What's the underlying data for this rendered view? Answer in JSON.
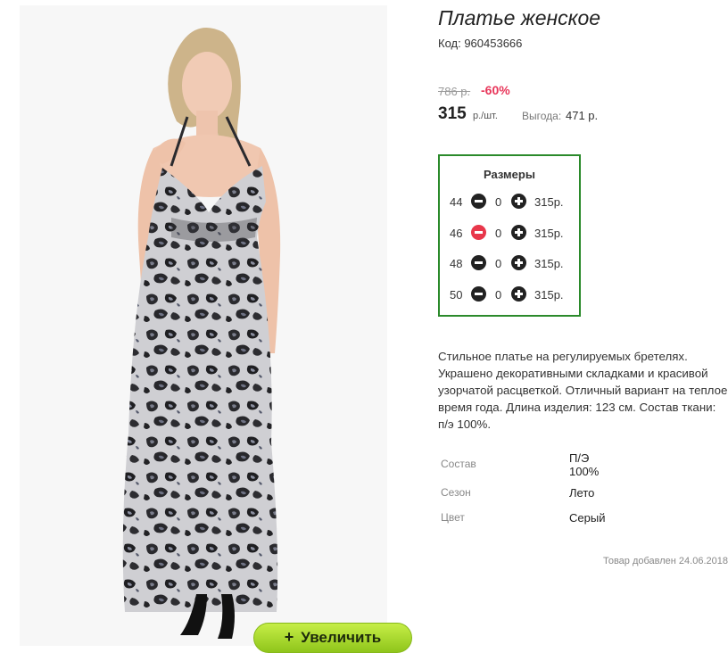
{
  "product": {
    "title": "Платье женское",
    "code": "Код: 960453666"
  },
  "pricing": {
    "old_price": "786 р.",
    "discount": "-60%",
    "price": "315",
    "unit": "р./шт.",
    "profit_label": "Выгода:",
    "profit_value": "471 р."
  },
  "sizes": {
    "title": "Размеры",
    "rows": [
      {
        "size": "44",
        "qty": "0",
        "price": "315р."
      },
      {
        "size": "46",
        "qty": "0",
        "price": "315р."
      },
      {
        "size": "48",
        "qty": "0",
        "price": "315р."
      },
      {
        "size": "50",
        "qty": "0",
        "price": "315р."
      }
    ]
  },
  "description": "Стильное платье на регулируемых бретелях. Украшено декоративными складками и красивой узорчатой расцветкой. Отличный вариант на теплое время года. Длина изделия: 123 см. Состав ткани: п/э 100%.",
  "attributes": [
    {
      "label": "Состав",
      "value_line1": "П/Э",
      "value_line2": "100%"
    },
    {
      "label": "Сезон",
      "value_line1": "Лето"
    },
    {
      "label": "Цвет",
      "value_line1": "Серый"
    }
  ],
  "added": "Товар добавлен 24.06.2018",
  "zoom_button": {
    "plus": "+",
    "label": "Увеличить"
  },
  "colors": {
    "accent_green": "#2b8a2b",
    "discount_red": "#e8365a",
    "button_green": "#8fc51b"
  }
}
